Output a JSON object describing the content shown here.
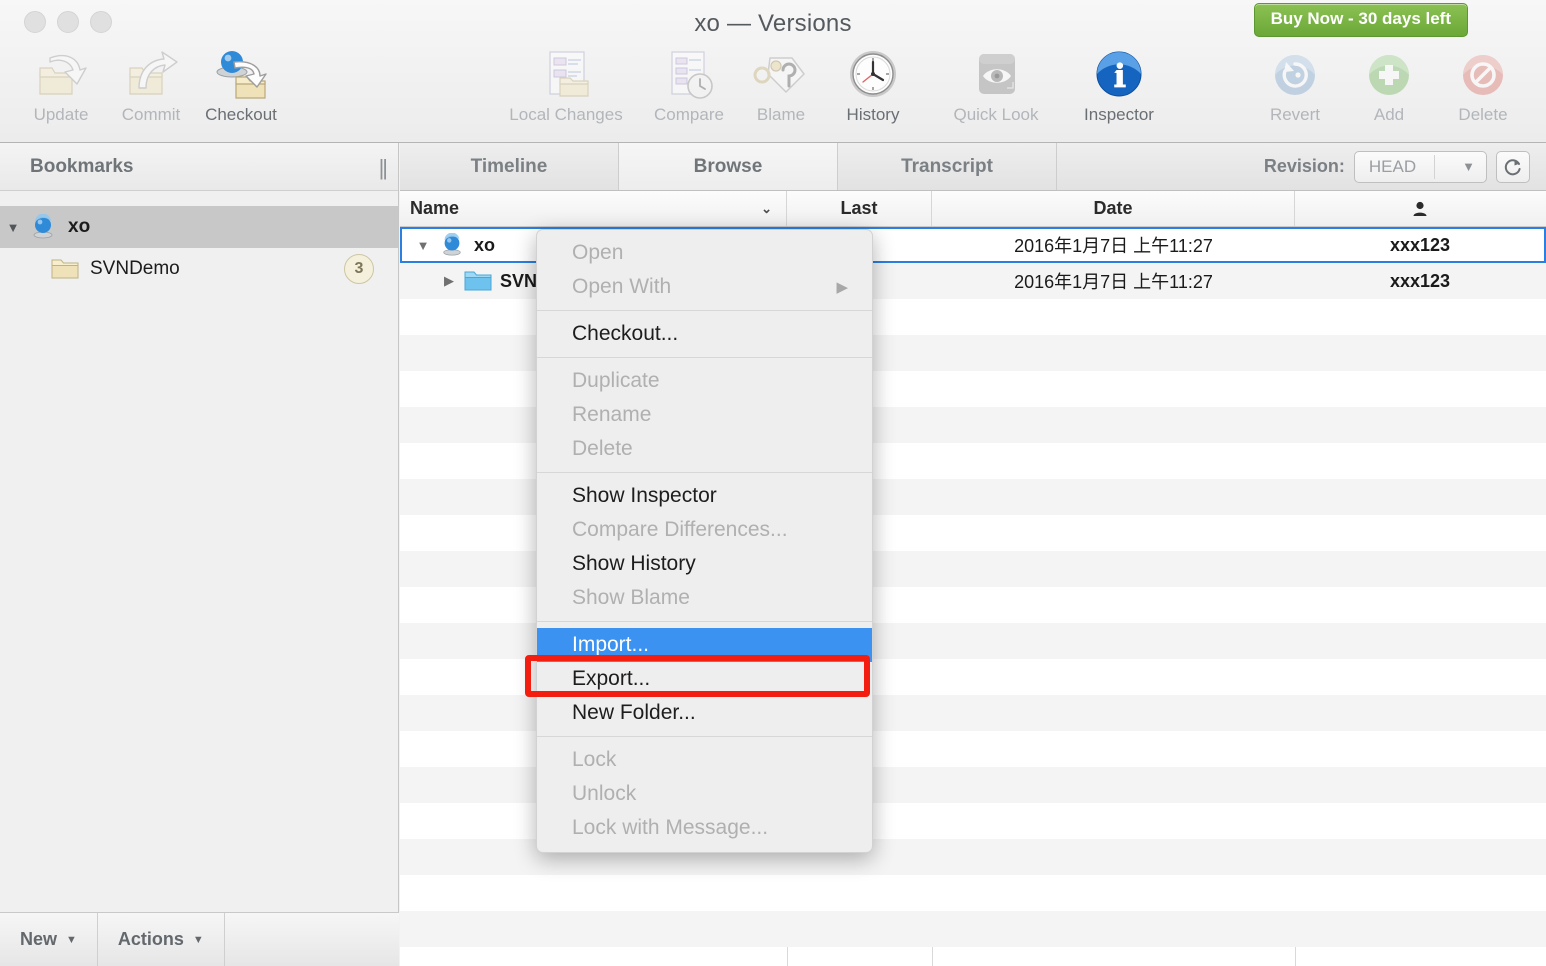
{
  "window": {
    "title": "xo — Versions",
    "traffic_lights": [
      "close-button",
      "minimize-button",
      "zoom-button"
    ]
  },
  "toolbar": {
    "left_items": [
      {
        "label": "Update",
        "icon": "update-folder-icon",
        "enabled": false
      },
      {
        "label": "Commit",
        "icon": "commit-folder-icon",
        "enabled": false
      },
      {
        "label": "Checkout",
        "icon": "checkout-folder-icon",
        "enabled": true
      }
    ],
    "middle_items": [
      {
        "label": "Local Changes",
        "icon": "local-changes-icon",
        "enabled": false
      },
      {
        "label": "Compare",
        "icon": "compare-icon",
        "enabled": false
      },
      {
        "label": "Blame",
        "icon": "blame-tag-icon",
        "enabled": false
      },
      {
        "label": "History",
        "icon": "history-clock-icon",
        "enabled": true
      },
      {
        "label": "Quick Look",
        "icon": "quick-look-eye-icon",
        "enabled": false
      },
      {
        "label": "Inspector",
        "icon": "inspector-info-icon",
        "enabled": true
      }
    ],
    "right_items": [
      {
        "label": "Revert",
        "icon": "revert-icon",
        "enabled": false
      },
      {
        "label": "Add",
        "icon": "add-plus-icon",
        "enabled": false
      },
      {
        "label": "Delete",
        "icon": "delete-prohibited-icon",
        "enabled": false
      }
    ],
    "buy_badge": "Buy Now - 30 days left"
  },
  "sidebar": {
    "header_title": "Bookmarks",
    "collapse_glyph": "||",
    "items": [
      {
        "label": "xo",
        "icon": "repository-globe-icon",
        "selected": true,
        "disclosure": "▼",
        "badge": ""
      },
      {
        "label": "SVNDemo",
        "icon": "folder-icon",
        "selected": false,
        "disclosure": "",
        "badge": "3"
      }
    ],
    "footer": {
      "new_label": "New",
      "actions_label": "Actions",
      "caret": "▼"
    }
  },
  "main": {
    "tabs": [
      {
        "label": "Timeline",
        "active": false
      },
      {
        "label": "Browse",
        "active": true
      },
      {
        "label": "Transcript",
        "active": false
      }
    ],
    "revision": {
      "label": "Revision:",
      "value": "HEAD",
      "caret": "▼",
      "refresh_icon": "refresh-icon"
    },
    "table": {
      "columns": [
        {
          "key": "name",
          "label": "Name",
          "sort_caret": "⌄"
        },
        {
          "key": "last",
          "label": "Last"
        },
        {
          "key": "date",
          "label": "Date"
        },
        {
          "key": "user",
          "label": "",
          "icon": "person-icon"
        }
      ],
      "rows": [
        {
          "name": "xo",
          "icon": "repository-globe-icon",
          "disclosure": "▼",
          "indent": 0,
          "last": "",
          "date": "2016年1月7日 上午11:27",
          "user": "xxx123",
          "selected": true
        },
        {
          "name": "SVNDemo",
          "icon": "folder-blue-icon",
          "disclosure": "▶",
          "indent": 1,
          "last": "",
          "date": "2016年1月7日 上午11:27",
          "user": "xxx123",
          "selected": false
        }
      ]
    }
  },
  "context_menu": {
    "groups": [
      [
        {
          "label": "Open",
          "enabled": false,
          "submenu": false
        },
        {
          "label": "Open With",
          "enabled": false,
          "submenu": true
        }
      ],
      [
        {
          "label": "Checkout...",
          "enabled": true,
          "submenu": false
        }
      ],
      [
        {
          "label": "Duplicate",
          "enabled": false,
          "submenu": false
        },
        {
          "label": "Rename",
          "enabled": false,
          "submenu": false
        },
        {
          "label": "Delete",
          "enabled": false,
          "submenu": false
        }
      ],
      [
        {
          "label": "Show Inspector",
          "enabled": true,
          "submenu": false
        },
        {
          "label": "Compare Differences...",
          "enabled": false,
          "submenu": false
        },
        {
          "label": "Show History",
          "enabled": true,
          "submenu": false
        },
        {
          "label": "Show Blame",
          "enabled": false,
          "submenu": false
        }
      ],
      [
        {
          "label": "Import...",
          "enabled": true,
          "submenu": false,
          "highlighted": true
        },
        {
          "label": "Export...",
          "enabled": true,
          "submenu": false
        },
        {
          "label": "New Folder...",
          "enabled": true,
          "submenu": false
        }
      ],
      [
        {
          "label": "Lock",
          "enabled": false,
          "submenu": false
        },
        {
          "label": "Unlock",
          "enabled": false,
          "submenu": false
        },
        {
          "label": "Lock with Message...",
          "enabled": false,
          "submenu": false
        }
      ]
    ],
    "submenu_arrow": "▶"
  },
  "annotation": {
    "highlight_color": "#f41e10",
    "target": "Import..."
  },
  "colors": {
    "menu_highlight": "#3b92f0",
    "selection_ring": "#2a7fe0",
    "buy_badge_green": "#6aa838",
    "badge_cream": "#f4f0db"
  }
}
